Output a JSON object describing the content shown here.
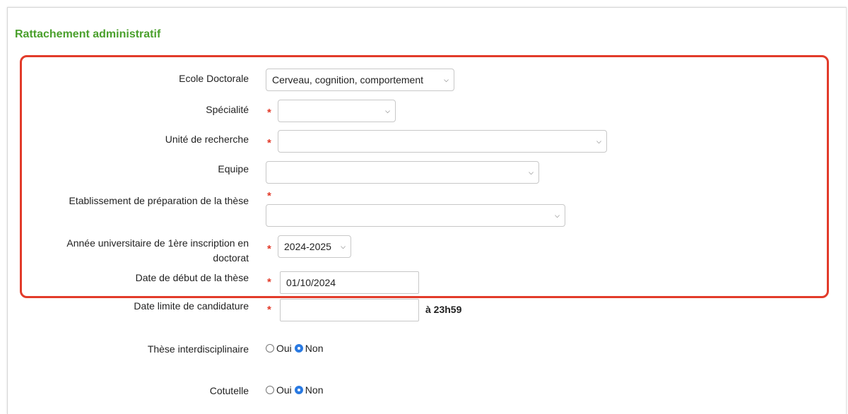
{
  "section": {
    "title": "Rattachement administratif"
  },
  "fields": {
    "ecole": {
      "label": "Ecole Doctorale",
      "value": "Cerveau, cognition, comportement"
    },
    "specialite": {
      "label": "Spécialité",
      "value": ""
    },
    "unite": {
      "label": "Unité de recherche",
      "value": ""
    },
    "equipe": {
      "label": "Equipe",
      "value": ""
    },
    "etablissement": {
      "label": "Etablissement de préparation de la thèse",
      "value": ""
    },
    "annee": {
      "label_line1": "Année universitaire de 1ère inscription en",
      "label_line2": "doctorat",
      "value": "2024-2025"
    },
    "date_debut": {
      "label": "Date de début de la thèse",
      "value": "01/10/2024"
    },
    "date_limite": {
      "label": "Date limite de candidature",
      "value": "",
      "suffix": "à 23h59"
    },
    "interdisciplinaire": {
      "label": "Thèse interdisciplinaire",
      "option_oui": "Oui",
      "option_non": "Non",
      "selected": "Non"
    },
    "cotutelle": {
      "label": "Cotutelle",
      "option_oui": "Oui",
      "option_non": "Non",
      "selected": "Non"
    }
  },
  "required_marker": "*",
  "colors": {
    "title": "#4aa02c",
    "highlight": "#e23b2a",
    "required": "#e23b2a",
    "radio_selected": "#2a7ae2"
  }
}
